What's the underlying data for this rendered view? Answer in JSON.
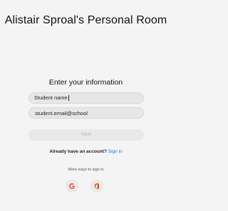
{
  "room": {
    "title": "Alistair Sproal's Personal Room"
  },
  "form": {
    "heading": "Enter your information",
    "name_value": "Student name",
    "email_value": "student.email@school",
    "next_label": "Next"
  },
  "account": {
    "prompt": "Already have an account?",
    "sign_in_label": "Sign in",
    "link_color": "#1a7ad4"
  },
  "more_ways": {
    "label": "More ways to sign in",
    "providers": [
      {
        "icon": "google-icon",
        "color": "#ea4335"
      },
      {
        "icon": "office-icon",
        "color": "#eb3c00"
      }
    ]
  }
}
